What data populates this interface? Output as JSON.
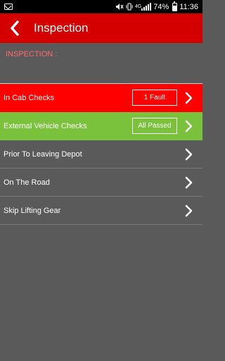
{
  "status_bar": {
    "signal_tag": "4G",
    "battery_percent": "74%",
    "time": "11:36"
  },
  "app_bar": {
    "title": "Inspection"
  },
  "section": {
    "label": "INSPECTION :"
  },
  "rows": [
    {
      "label": "In Cab Checks",
      "badge": "1 Fault",
      "state": "fault",
      "color": "#ff0000"
    },
    {
      "label": "External Vehicle Checks",
      "badge": "All Passed",
      "state": "passed",
      "color": "#7ac23c"
    },
    {
      "label": "Prior To Leaving Depot"
    },
    {
      "label": "On The Road"
    },
    {
      "label": "Skip Lifting Gear"
    }
  ],
  "colors": {
    "app_bar": "#d40000",
    "background": "#5a5a5a",
    "section_label": "#ff6a6a"
  },
  "icons": [
    "mail-icon",
    "mute-icon",
    "signal-icon",
    "battery-icon",
    "back-arrow-icon",
    "chevron-right-icon"
  ]
}
